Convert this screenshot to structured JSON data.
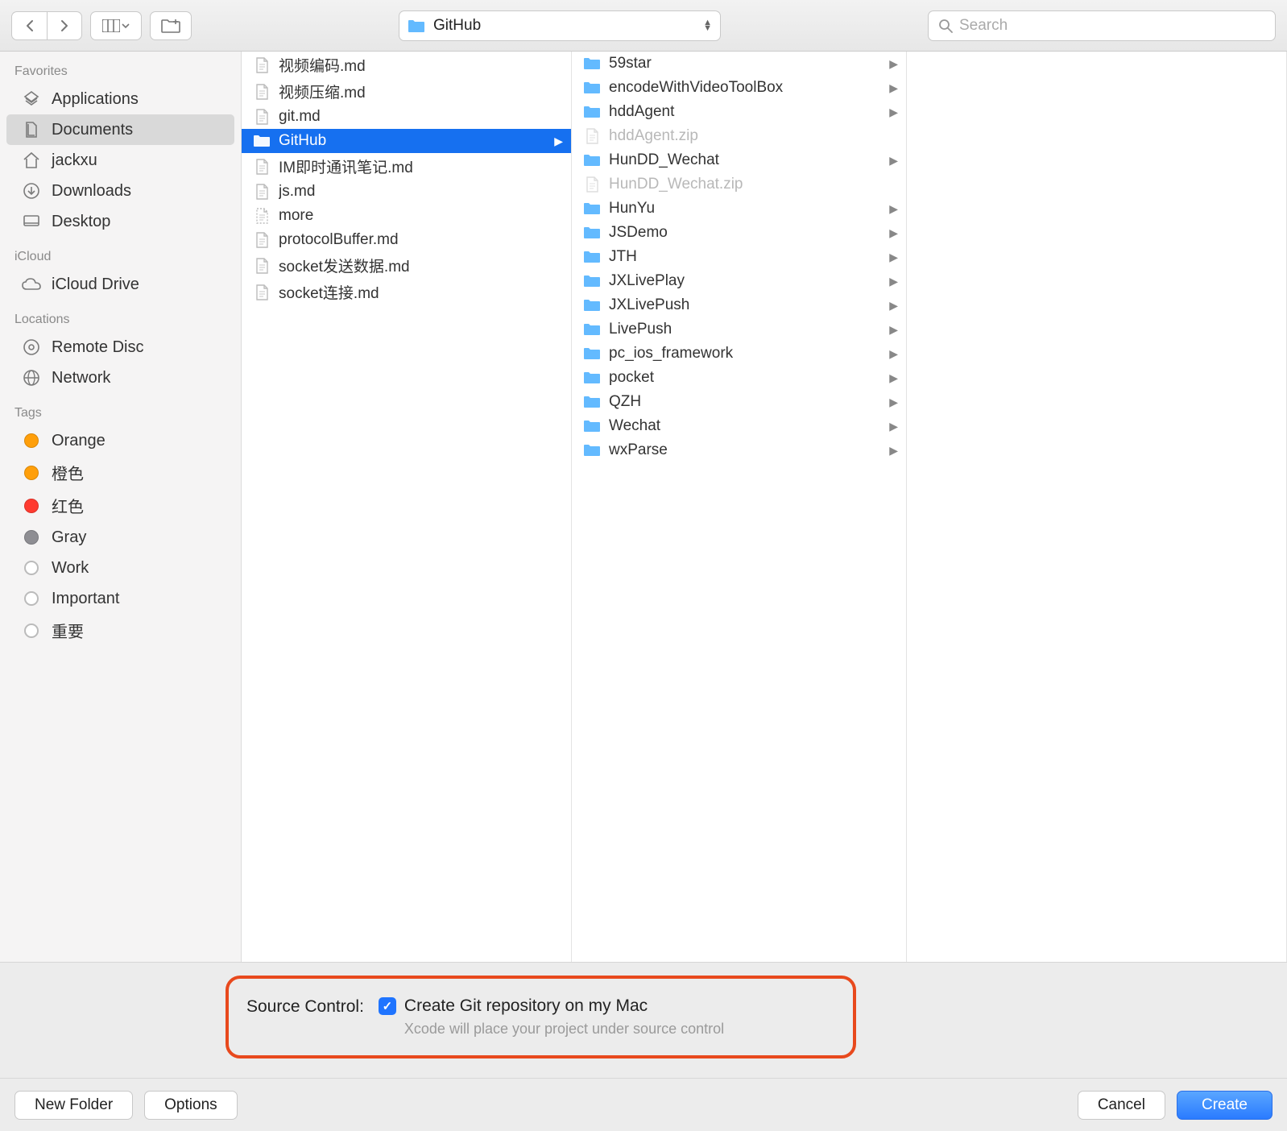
{
  "toolbar": {
    "path_label": "GitHub",
    "search_placeholder": "Search"
  },
  "sidebar": {
    "sections": [
      {
        "header": "Favorites",
        "items": [
          {
            "icon": "applications",
            "label": "Applications"
          },
          {
            "icon": "documents",
            "label": "Documents",
            "selected": true
          },
          {
            "icon": "home",
            "label": "jackxu"
          },
          {
            "icon": "downloads",
            "label": "Downloads"
          },
          {
            "icon": "desktop",
            "label": "Desktop"
          }
        ]
      },
      {
        "header": "iCloud",
        "items": [
          {
            "icon": "icloud",
            "label": "iCloud Drive"
          }
        ]
      },
      {
        "header": "Locations",
        "items": [
          {
            "icon": "disc",
            "label": "Remote Disc"
          },
          {
            "icon": "network",
            "label": "Network"
          }
        ]
      },
      {
        "header": "Tags",
        "items": [
          {
            "icon": "tag",
            "color": "#ff9f0a",
            "label": "Orange"
          },
          {
            "icon": "tag",
            "color": "#ff9f0a",
            "label": "橙色"
          },
          {
            "icon": "tag",
            "color": "#ff3b30",
            "label": "红色"
          },
          {
            "icon": "tag",
            "color": "#8e8e93",
            "label": "Gray"
          },
          {
            "icon": "tag",
            "color": "",
            "label": "Work"
          },
          {
            "icon": "tag",
            "color": "",
            "label": "Important"
          },
          {
            "icon": "tag",
            "color": "",
            "label": "重要"
          }
        ]
      }
    ]
  },
  "columns": [
    {
      "items": [
        {
          "type": "file",
          "name": "视频编码.md"
        },
        {
          "type": "file",
          "name": "视频压缩.md"
        },
        {
          "type": "file",
          "name": "git.md"
        },
        {
          "type": "folder",
          "name": "GitHub",
          "selected": true,
          "hasChildren": true
        },
        {
          "type": "file",
          "name": "IM即时通讯笔记.md"
        },
        {
          "type": "file",
          "name": "js.md"
        },
        {
          "type": "file",
          "name": "more",
          "dashed": true
        },
        {
          "type": "file",
          "name": "protocolBuffer.md"
        },
        {
          "type": "file",
          "name": "socket发送数据.md"
        },
        {
          "type": "file",
          "name": "socket连接.md"
        }
      ]
    },
    {
      "items": [
        {
          "type": "folder",
          "name": "59star",
          "hasChildren": true
        },
        {
          "type": "folder",
          "name": "encodeWithVideoToolBox",
          "hasChildren": true
        },
        {
          "type": "folder",
          "name": "hddAgent",
          "hasChildren": true
        },
        {
          "type": "file",
          "name": "hddAgent.zip",
          "dim": true
        },
        {
          "type": "folder",
          "name": "HunDD_Wechat",
          "hasChildren": true
        },
        {
          "type": "file",
          "name": "HunDD_Wechat.zip",
          "dim": true
        },
        {
          "type": "folder",
          "name": "HunYu",
          "hasChildren": true
        },
        {
          "type": "folder",
          "name": "JSDemo",
          "hasChildren": true
        },
        {
          "type": "folder",
          "name": "JTH",
          "hasChildren": true
        },
        {
          "type": "folder",
          "name": "JXLivePlay",
          "hasChildren": true
        },
        {
          "type": "folder",
          "name": "JXLivePush",
          "hasChildren": true
        },
        {
          "type": "folder",
          "name": "LivePush",
          "hasChildren": true
        },
        {
          "type": "folder",
          "name": "pc_ios_framework",
          "hasChildren": true
        },
        {
          "type": "folder",
          "name": "pocket",
          "hasChildren": true
        },
        {
          "type": "folder",
          "name": "QZH",
          "hasChildren": true
        },
        {
          "type": "folder",
          "name": "Wechat",
          "hasChildren": true
        },
        {
          "type": "folder",
          "name": "wxParse",
          "hasChildren": true
        }
      ]
    }
  ],
  "source_control": {
    "label": "Source Control:",
    "checkbox_label": "Create Git repository on my Mac",
    "subtext": "Xcode will place your project under source control",
    "checked": true
  },
  "footer": {
    "new_folder": "New Folder",
    "options": "Options",
    "cancel": "Cancel",
    "create": "Create"
  }
}
